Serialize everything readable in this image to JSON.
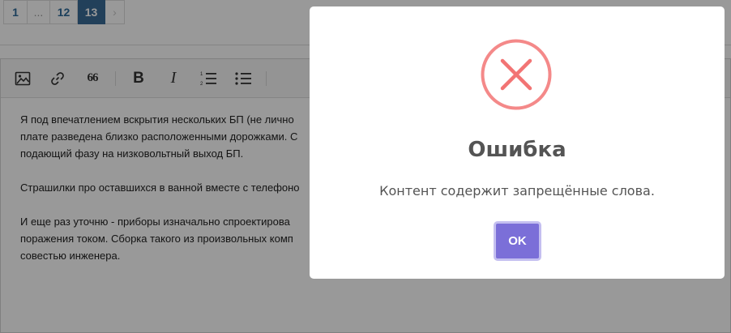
{
  "pagination": {
    "pages": [
      "1",
      "...",
      "12",
      "13"
    ],
    "current": "13",
    "next_glyph": "›"
  },
  "toolbar": {
    "quote_glyph": "66",
    "bold_glyph": "B",
    "italic_glyph": "I"
  },
  "editor": {
    "paragraphs": [
      [
        "Я под впечатлением вскрытия нескольких БП (не лично",
        "плате разведена близко расположенными дорожками. С",
        "подающий фазу на низковольтный выход БП."
      ],
      [
        "Страшилки про оставшихся в ванной вместе с телефоно"
      ],
      [
        "И еще раз уточню - приборы изначально спроектирова",
        "поражения током. Сборка такого из произвольных комп",
        "совестью инженера."
      ]
    ]
  },
  "modal": {
    "title": "Ошибка",
    "message": "Контент содержит запрещённые слова.",
    "ok_label": "OK",
    "icon_color": "#f27474",
    "button_color": "#7b6fd8"
  }
}
